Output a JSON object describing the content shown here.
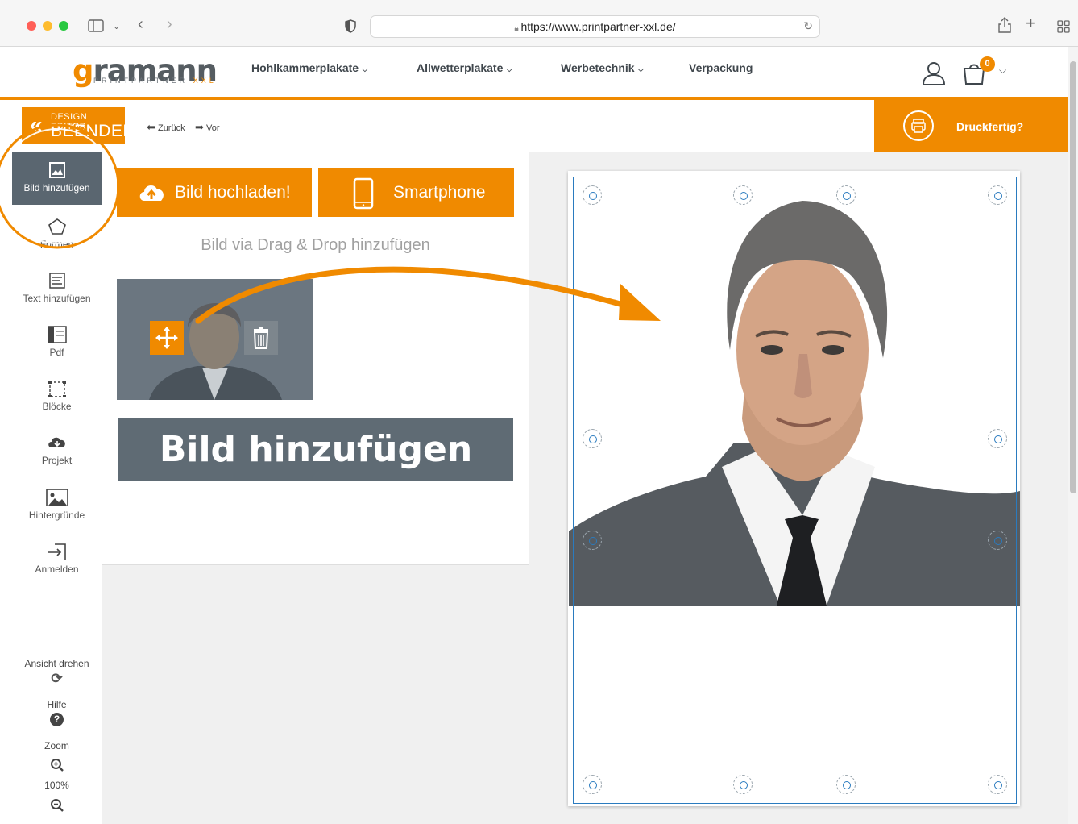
{
  "browser": {
    "url": "https://www.printpartner-xxl.de/"
  },
  "header": {
    "logo_main_g": "g",
    "logo_main_rest": "ramann",
    "logo_sub": "PRINTPARTNER",
    "logo_sub_xxl": "XXL",
    "nav": [
      {
        "label": "Hohlkammerplakate"
      },
      {
        "label": "Allwetterplakate"
      },
      {
        "label": "Werbetechnik"
      },
      {
        "label": "Verpackung"
      }
    ],
    "cart_count": "0"
  },
  "toolbar": {
    "end_editor_line1": "DESIGN EDITOR",
    "end_editor_line2": "BEENDEN",
    "undo": "Zurück",
    "redo": "Vor",
    "print_ready": "Druckfertig?"
  },
  "sidebar": {
    "items": [
      {
        "label": "Bild hinzufügen",
        "icon": "image-icon"
      },
      {
        "label": "Formen",
        "icon": "pentagon-icon"
      },
      {
        "label": "Text hinzufügen",
        "icon": "text-icon"
      },
      {
        "label": "Pdf",
        "icon": "pdf-layout-icon"
      },
      {
        "label": "Blöcke",
        "icon": "blocks-icon"
      },
      {
        "label": "Projekt",
        "icon": "cloud-download-icon"
      },
      {
        "label": "Hintergründe",
        "icon": "landscape-icon"
      },
      {
        "label": "Anmelden",
        "icon": "login-icon"
      }
    ],
    "rotate_label": "Ansicht drehen",
    "help_label": "Hilfe",
    "zoom_label": "Zoom",
    "zoom_value": "100%"
  },
  "panel": {
    "upload_button": "Bild hochladen!",
    "smartphone_button": "Smartphone",
    "drag_drop_hint": "Bild via Drag & Drop hinzufügen"
  },
  "overlay": {
    "caption": "Bild hinzufügen"
  },
  "colors": {
    "accent": "#f08a00",
    "slate": "#5a6670",
    "selection": "#2a7bbf"
  }
}
